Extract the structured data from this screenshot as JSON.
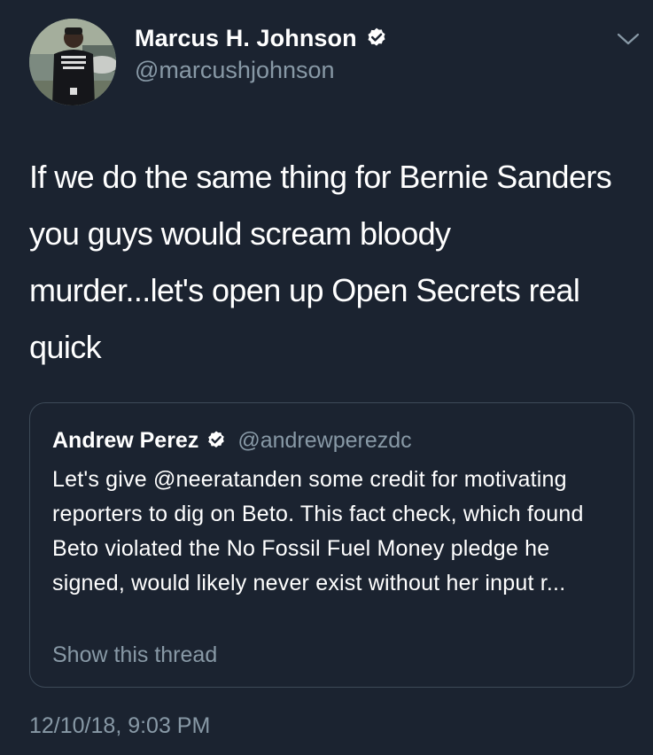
{
  "author": {
    "display_name": "Marcus H. Johnson",
    "handle": "@marcushjohnson",
    "verified": true,
    "avatar_shirt_text": "PROVE PEOPLE WRONG"
  },
  "tweet": {
    "text": "If we do the same thing for Bernie Sanders you guys would scream bloody murder...let's open up Open Secrets real quick",
    "timestamp": "12/10/18, 9:03 PM"
  },
  "quoted_tweet": {
    "display_name": "Andrew Perez",
    "handle": "@andrewperezdc",
    "verified": true,
    "text": "Let's give @neeratanden some credit for motivating reporters to dig on Beto. This fact check, which found Beto violated the No Fossil Fuel Money pledge he signed, would likely never exist without her input r...",
    "show_thread_label": "Show this thread"
  },
  "icons": {
    "verified": "verified-badge-icon",
    "menu": "chevron-down-icon"
  },
  "colors": {
    "background": "#1b2330",
    "primary_text": "#ffffff",
    "secondary_text": "#8899a6",
    "border": "#3d4a58"
  }
}
